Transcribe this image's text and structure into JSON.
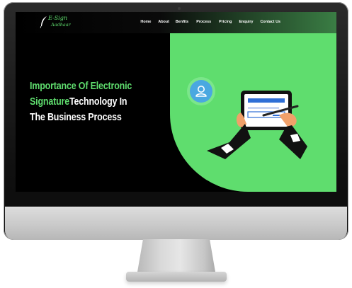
{
  "brand": {
    "logo_line1": "E-Sign",
    "logo_line2": "Aadhaar"
  },
  "nav": {
    "items": [
      "Home",
      "About",
      "Benfits",
      "Process",
      "Pricing",
      "Enquiry",
      "Contact Us"
    ]
  },
  "hero": {
    "line1": "Importance Of Electronic",
    "line2_green": "Signature",
    "line2_rest": "Technology In",
    "line3": "The Business Process"
  },
  "colors": {
    "accent_green": "#5fdd6e",
    "background": "#000000",
    "user_icon_blue": "#4aa8e0"
  },
  "icons": [
    "feather-pen-icon",
    "user-icon",
    "tablet-signature-illustration"
  ]
}
